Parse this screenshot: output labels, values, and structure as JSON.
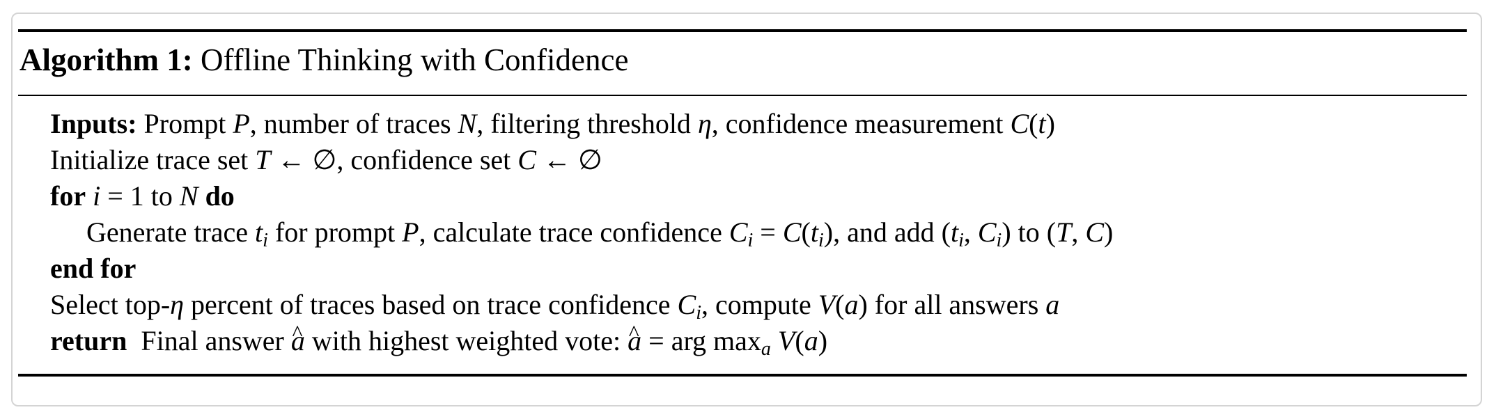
{
  "algorithm": {
    "caption_label": "Algorithm 1:",
    "caption_title": "Offline Thinking with Confidence"
  },
  "lines": {
    "inputs_keyword": "Inputs:",
    "inputs_text": "Prompt P, number of traces N, filtering threshold η, confidence measurement C(t)",
    "initialize_text": "Initialize trace set T ← ∅, confidence set C ← ∅",
    "for_keyword": "for",
    "for_text": "i = 1 to N",
    "do_keyword": "do",
    "generate_text": "Generate trace tᵢ for prompt P, calculate trace confidence Cᵢ = C(tᵢ), and add (tᵢ, Cᵢ) to (T, C)",
    "end_for_keyword": "end for",
    "select_text": "Select top-η percent of traces based on trace confidence Cᵢ, compute V(a) for all answers a",
    "return_keyword": "return",
    "return_text": "Final answer â with highest weighted vote: â = arg maxₐ V(a)"
  }
}
